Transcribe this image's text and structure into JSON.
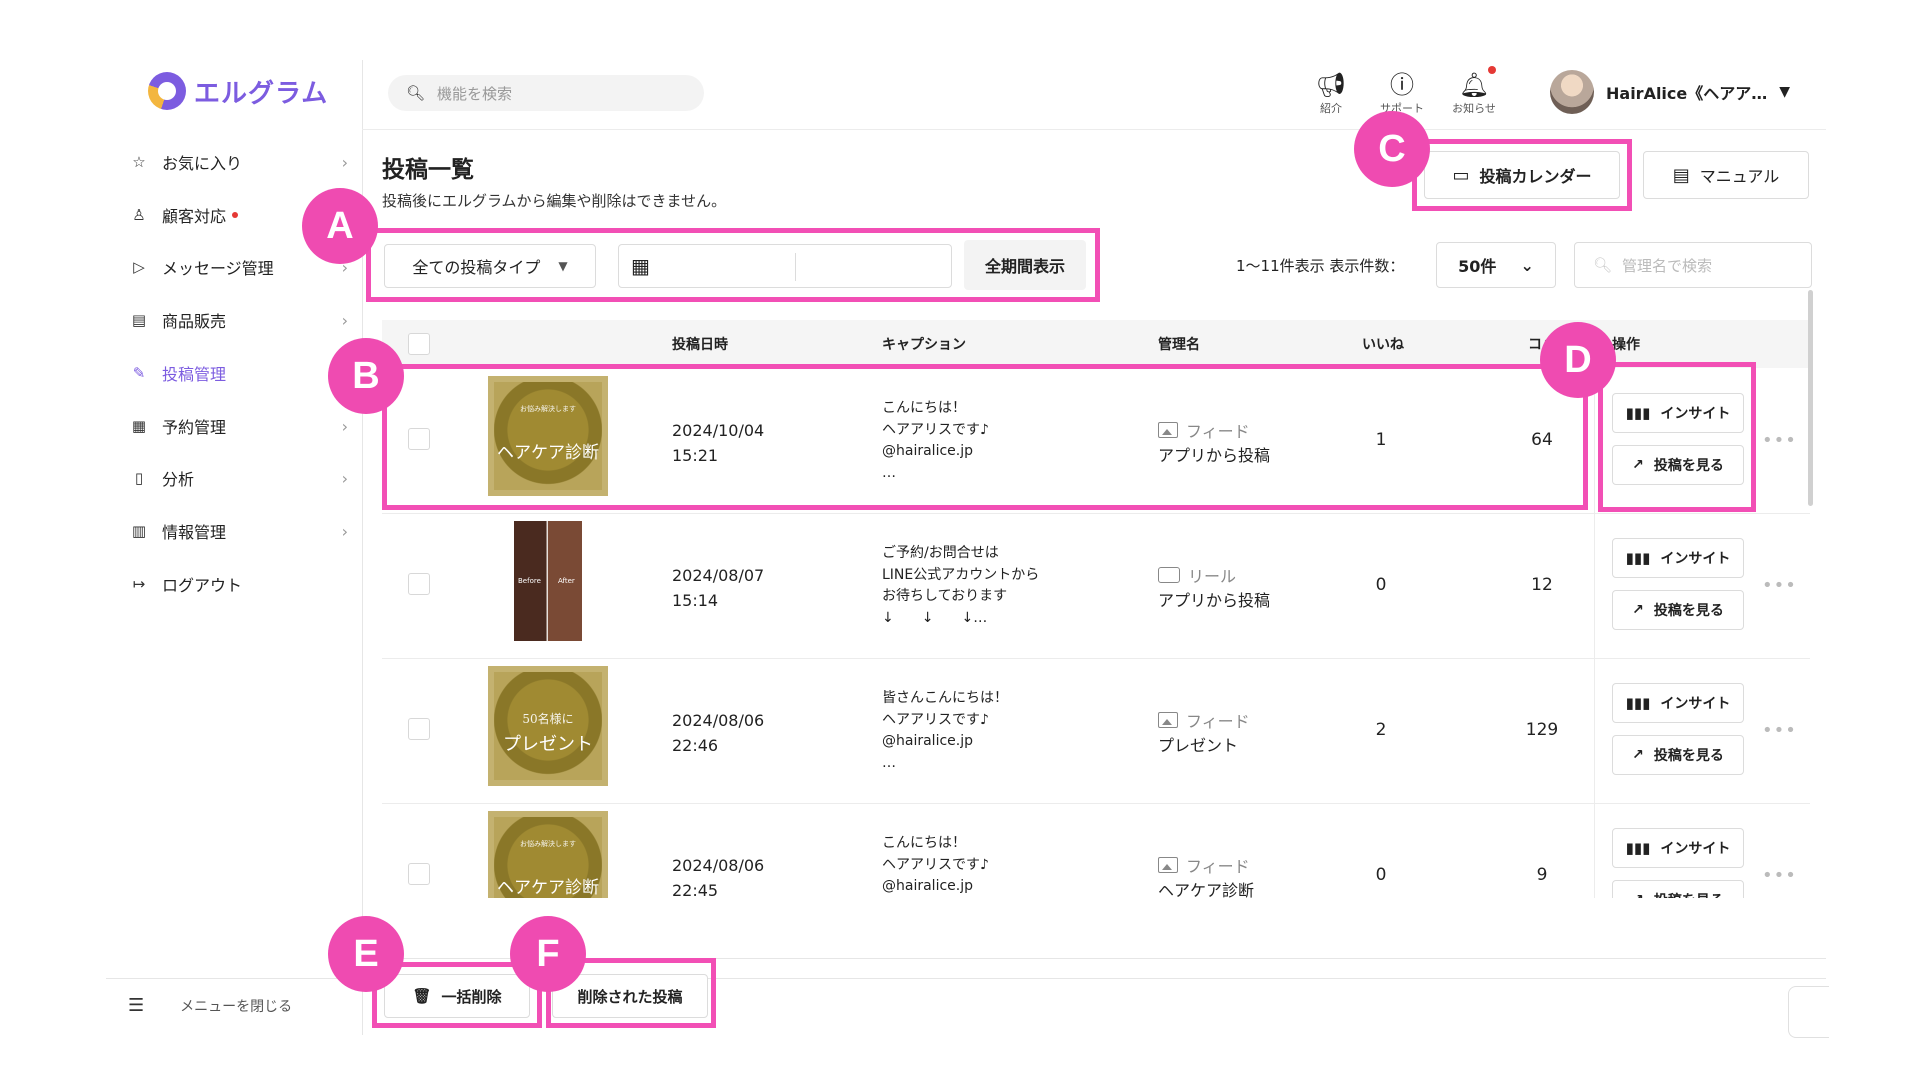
{
  "app": {
    "name": "エルグラム"
  },
  "search": {
    "placeholder": "機能を検索"
  },
  "header": {
    "icons": [
      {
        "label": "紹介",
        "icon": "megaphone-icon"
      },
      {
        "label": "サポート",
        "icon": "help-icon"
      },
      {
        "label": "お知らせ",
        "icon": "bell-icon"
      }
    ],
    "user_name": "HairAlice《ヘアア…"
  },
  "sidebar": {
    "items": [
      {
        "label": "お気に入り",
        "icon": "star-icon",
        "active": false
      },
      {
        "label": "顧客対応",
        "icon": "user-icon",
        "active": false,
        "badge": true
      },
      {
        "label": "メッセージ管理",
        "icon": "send-icon",
        "active": false
      },
      {
        "label": "商品販売",
        "icon": "shop-icon",
        "active": false
      },
      {
        "label": "投稿管理",
        "icon": "edit-icon",
        "active": true
      },
      {
        "label": "予約管理",
        "icon": "calendar-icon",
        "active": false
      },
      {
        "label": "分析",
        "icon": "report-icon",
        "active": false
      },
      {
        "label": "情報管理",
        "icon": "chart-icon",
        "active": false
      },
      {
        "label": "ログアウト",
        "icon": "logout-icon",
        "active": false
      }
    ],
    "close_label": "メニューを閉じる"
  },
  "page": {
    "title": "投稿一覧",
    "subtitle": "投稿後にエルグラムから編集や削除はできません。",
    "calendar_button": "投稿カレンダー",
    "manual_button": "マニュアル"
  },
  "filters": {
    "post_type": "全ての投稿タイプ",
    "all_period": "全期間表示",
    "range_info": "1～11件表示 表示件数：",
    "per_page": "50件",
    "name_search_placeholder": "管理名で検索"
  },
  "table": {
    "headers": {
      "date": "投稿日時",
      "caption": "キャプション",
      "name": "管理名",
      "likes": "いいね",
      "comments": "コメ",
      "ops": "操作"
    },
    "insight_label": "インサイト",
    "view_label": "投稿を見る",
    "rows": [
      {
        "date": "2024/10/04",
        "time": "15:21",
        "caption": "こんにちは！\nヘアアリスです♪\n@hairalice.jp\n…",
        "type": "フィード",
        "name": "アプリから投稿",
        "likes": "1",
        "comments": "64",
        "thumb_text": "ヘアケア診断",
        "thumb_sub": "お悩み解決します"
      },
      {
        "date": "2024/08/07",
        "time": "15:14",
        "caption": "ご予約/お問合せは\nLINE公式アカウントから\nお待ちしております\n↓　　↓　　↓…",
        "type": "リール",
        "name": "アプリから投稿",
        "likes": "0",
        "comments": "12",
        "thumb_before": "Before",
        "thumb_after": "After"
      },
      {
        "date": "2024/08/06",
        "time": "22:46",
        "caption": "皆さんこんにちは！\nヘアアリスです♪\n@hairalice.jp\n…",
        "type": "フィード",
        "name": "プレゼント",
        "likes": "2",
        "comments": "129",
        "thumb_text": "プレゼント",
        "thumb_sub": "50名様に"
      },
      {
        "date": "2024/08/06",
        "time": "22:45",
        "caption": "こんにちは！\nヘアアリスです♪\n@hairalice.jp",
        "type": "フィード",
        "name": "ヘアケア診断",
        "likes": "0",
        "comments": "9",
        "thumb_text": "ヘアケア診断",
        "thumb_sub": "お悩み解決します"
      }
    ]
  },
  "bottom": {
    "bulk_delete": "一括削除",
    "deleted_posts": "削除された投稿"
  },
  "annotations": {
    "a": "A",
    "b": "B",
    "c": "C",
    "d": "D",
    "e": "E",
    "f": "F"
  },
  "colors": {
    "brand": "#7c5ce0",
    "annotation": "#f24fb5",
    "alert": "#e53935"
  }
}
